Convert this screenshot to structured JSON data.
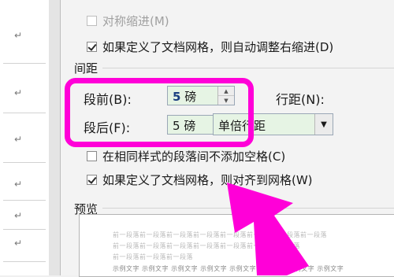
{
  "doc_marks": [
    "↵",
    "↵",
    "↵",
    "↵",
    "↵",
    "↵"
  ],
  "indent": {
    "mirror_indents": {
      "label": "对称缩进(M)",
      "checked": false,
      "disabled": true
    },
    "auto_adjust_right_indent": {
      "label": "如果定义了文档网格，则自动调整右缩进(D)",
      "checked": true
    }
  },
  "spacing": {
    "section_title": "间距",
    "before": {
      "label": "段前(B):",
      "value": "5",
      "unit": "磅"
    },
    "after": {
      "label": "段后(F):",
      "value": "5",
      "unit": "磅"
    },
    "line_spacing": {
      "label": "行距(N):",
      "value": "单倍行距"
    },
    "no_space_same_style": {
      "label": "在相同样式的段落间不添加空格(C)",
      "checked": false
    },
    "snap_to_grid": {
      "label": "如果定义了文档网格，则对齐到网格(W)",
      "checked": true
    }
  },
  "preview": {
    "section_title": "预览",
    "prev_text": "前一段落前一段落前一段落前一段落前一段落前一段落前一段落前一段落",
    "prev_text_short": "前一段落前一段落前一段落前一段落前一段落前一段落前一段落",
    "prev_text_end": "前一段落前一段落前一段落",
    "sample_text": "示例文字 示例文字 示例文字 示例文字 示例文字 示例文字 示例文字 示例文字"
  },
  "colors": {
    "highlight": "#ff00d8",
    "arrow": "#ff00d8",
    "field_bg": "#e6f4e4"
  }
}
